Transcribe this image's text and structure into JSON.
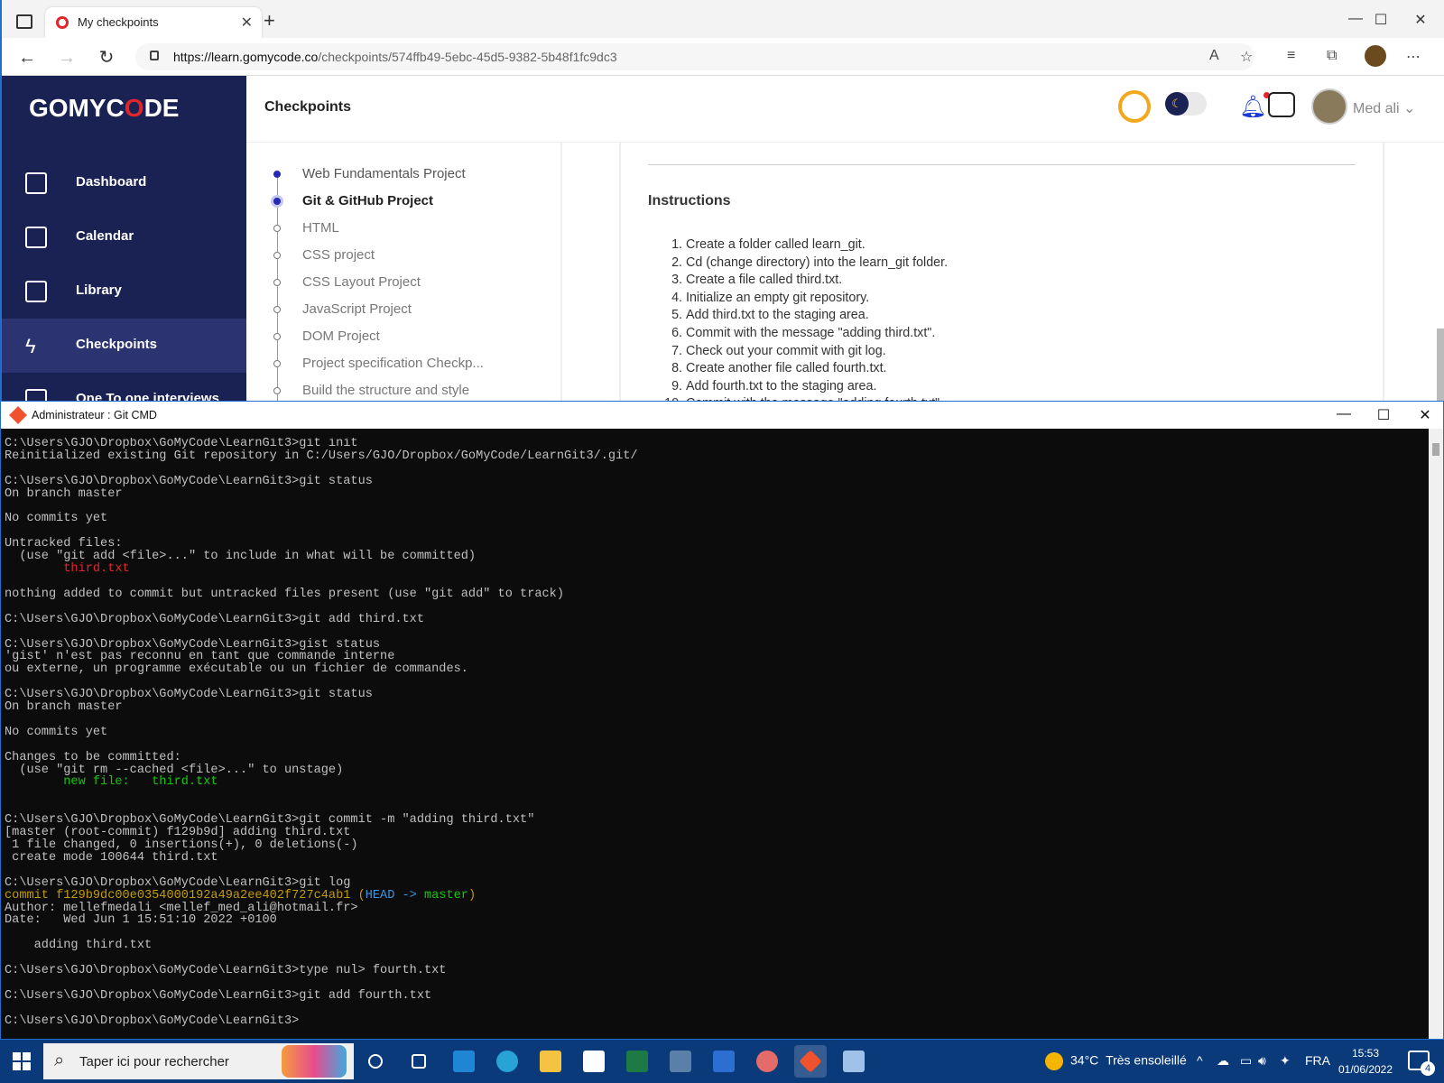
{
  "browser": {
    "tab_title": "My checkpoints",
    "url_host": "https://learn.gomycode.co",
    "url_path": "/checkpoints/574ffb49-5ebc-45d5-9382-5b48f1fc9dc3"
  },
  "app": {
    "logo": {
      "left": "GOMYC",
      "o": "O",
      "right": "DE"
    },
    "page_title": "Checkpoints",
    "username": "Med ali",
    "sidebar": [
      {
        "label": "Dashboard"
      },
      {
        "label": "Calendar"
      },
      {
        "label": "Library"
      },
      {
        "label": "Checkpoints"
      },
      {
        "label": "One To one interviews"
      }
    ],
    "checkpoints": [
      "Web Fundamentals Project",
      "Git & GitHub Project",
      "HTML",
      "CSS project",
      "CSS Layout Project",
      "JavaScript Project",
      "DOM Project",
      "Project specification Checkp...",
      "Build the structure and style"
    ],
    "instructions_title": "Instructions",
    "instructions": [
      "Create a folder called learn_git.",
      "Cd (change directory) into the learn_git folder.",
      "Create a file called third.txt.",
      "Initialize an empty git repository.",
      "Add third.txt to the staging area.",
      "Commit with the message \"adding third.txt\".",
      "Check out your commit with git log.",
      "Create another file called fourth.txt.",
      "Add fourth.txt to the staging area.",
      "Commit with the message \"adding fourth.txt\""
    ]
  },
  "cmd": {
    "title": "Administrateur : Git CMD",
    "prompt": "C:\\Users\\GJO\\Dropbox\\GoMyCode\\LearnGit3>",
    "lines": [
      "C:\\Users\\GJO\\Dropbox\\GoMyCode\\LearnGit3>git init",
      "Reinitialized existing Git repository in C:/Users/GJO/Dropbox/GoMyCode/LearnGit3/.git/",
      "",
      "C:\\Users\\GJO\\Dropbox\\GoMyCode\\LearnGit3>git status",
      "On branch master",
      "",
      "No commits yet",
      "",
      "Untracked files:",
      "  (use \"git add <file>...\" to include in what will be committed)",
      "        third.txt",
      "",
      "nothing added to commit but untracked files present (use \"git add\" to track)",
      "",
      "C:\\Users\\GJO\\Dropbox\\GoMyCode\\LearnGit3>git add third.txt",
      "",
      "C:\\Users\\GJO\\Dropbox\\GoMyCode\\LearnGit3>gist status",
      "'gist' n'est pas reconnu en tant que commande interne",
      "ou externe, un programme exécutable ou un fichier de commandes.",
      "",
      "C:\\Users\\GJO\\Dropbox\\GoMyCode\\LearnGit3>git status",
      "On branch master",
      "",
      "No commits yet",
      "",
      "Changes to be committed:",
      "  (use \"git rm --cached <file>...\" to unstage)",
      "        new file:   third.txt",
      "",
      "",
      "C:\\Users\\GJO\\Dropbox\\GoMyCode\\LearnGit3>git commit -m \"adding third.txt\"",
      "[master (root-commit) f129b9d] adding third.txt",
      " 1 file changed, 0 insertions(+), 0 deletions(-)",
      " create mode 100644 third.txt",
      "",
      "C:\\Users\\GJO\\Dropbox\\GoMyCode\\LearnGit3>git log",
      "commit f129b9dc00e0354000192a49a2ee402f727c4ab1 (HEAD -> master)",
      "Author: mellefmedali <mellef_med_ali@hotmail.fr>",
      "Date:   Wed Jun 1 15:51:10 2022 +0100",
      "",
      "    adding third.txt",
      "",
      "C:\\Users\\GJO\\Dropbox\\GoMyCode\\LearnGit3>type nul> fourth.txt",
      "",
      "C:\\Users\\GJO\\Dropbox\\GoMyCode\\LearnGit3>git add fourth.txt",
      "",
      "C:\\Users\\GJO\\Dropbox\\GoMyCode\\LearnGit3>"
    ]
  },
  "taskbar": {
    "search_placeholder": "Taper ici pour rechercher",
    "temperature": "34°C",
    "weather": "Très ensoleillé",
    "language": "FRA",
    "time": "15:53",
    "date": "01/06/2022",
    "notifications": "4"
  },
  "colors": {
    "sidebar_bg": "#1a2254",
    "accent_red": "#e0262c",
    "accent_blue": "#2329b4",
    "terminal_bg": "#0c0c0c"
  }
}
